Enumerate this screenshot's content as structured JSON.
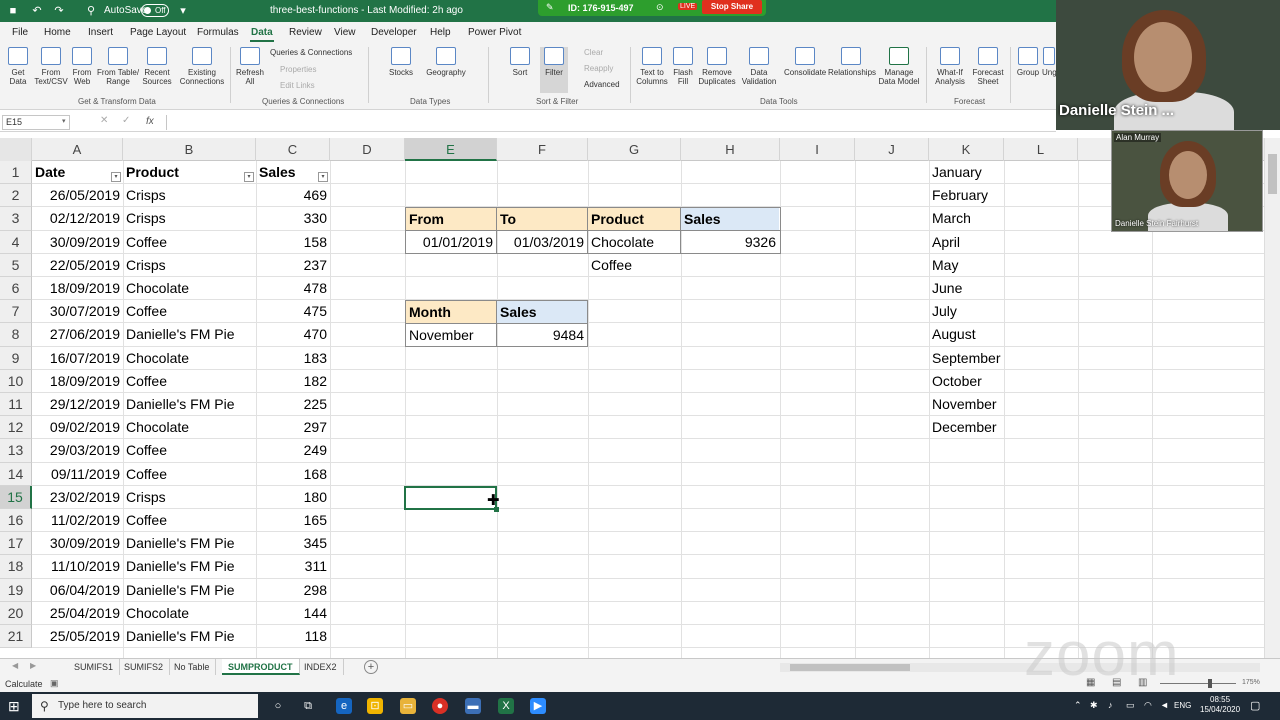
{
  "titlebar": {
    "autosave_label": "AutoSave",
    "autosave_state": "Off",
    "doc_title": "three-best-functions  -  Last Modified: 2h ago",
    "share_id": "ID: 176-915-497",
    "live_badge": "LIVE",
    "stop_share": "Stop Share"
  },
  "menu": {
    "tabs": [
      "File",
      "Home",
      "Insert",
      "Page Layout",
      "Formulas",
      "Data",
      "Review",
      "View",
      "Developer",
      "Help",
      "Power Pivot"
    ],
    "active": "Data"
  },
  "ribbon": {
    "get_data": "Get\nData",
    "from_text": "From\nText/CSV",
    "from_web": "From\nWeb",
    "from_table": "From Table/\nRange",
    "recent_sources": "Recent\nSources",
    "existing_connections": "Existing\nConnections",
    "group_get_transform": "Get & Transform Data",
    "refresh_all": "Refresh\nAll",
    "queries_connections": "Queries & Connections",
    "properties": "Properties",
    "edit_links": "Edit Links",
    "group_queries": "Queries & Connections",
    "stocks": "Stocks",
    "geography": "Geography",
    "group_data_types": "Data Types",
    "sort": "Sort",
    "filter": "Filter",
    "clear": "Clear",
    "reapply": "Reapply",
    "advanced": "Advanced",
    "group_sort_filter": "Sort & Filter",
    "text_to_columns": "Text to\nColumns",
    "flash_fill": "Flash\nFill",
    "remove_duplicates": "Remove\nDuplicates",
    "data_validation": "Data\nValidation",
    "consolidate": "Consolidate",
    "relationships": "Relationships",
    "manage_data_model": "Manage\nData Model",
    "group_data_tools": "Data Tools",
    "what_if": "What-If\nAnalysis",
    "forecast_sheet": "Forecast\nSheet",
    "group_forecast": "Forecast",
    "group": "Group",
    "ungroup": "Ung"
  },
  "formula_bar": {
    "name_box": "E15",
    "fx": "fx",
    "formula": ""
  },
  "columns": [
    "A",
    "B",
    "C",
    "D",
    "E",
    "F",
    "G",
    "H",
    "I",
    "J",
    "K",
    "L"
  ],
  "rows": [
    "1",
    "2",
    "3",
    "4",
    "5",
    "6",
    "7",
    "8",
    "9",
    "10",
    "11",
    "12",
    "13",
    "14",
    "15",
    "16",
    "17",
    "18",
    "19",
    "20",
    "21"
  ],
  "table": {
    "headers": [
      "Date",
      "Product",
      "Sales"
    ],
    "rows": [
      [
        "26/05/2019",
        "Crisps",
        "469"
      ],
      [
        "02/12/2019",
        "Crisps",
        "330"
      ],
      [
        "30/09/2019",
        "Coffee",
        "158"
      ],
      [
        "22/05/2019",
        "Crisps",
        "237"
      ],
      [
        "18/09/2019",
        "Chocolate",
        "478"
      ],
      [
        "30/07/2019",
        "Coffee",
        "475"
      ],
      [
        "27/06/2019",
        "Danielle's FM Pie",
        "470"
      ],
      [
        "16/07/2019",
        "Chocolate",
        "183"
      ],
      [
        "18/09/2019",
        "Coffee",
        "182"
      ],
      [
        "29/12/2019",
        "Danielle's FM Pie",
        "225"
      ],
      [
        "09/02/2019",
        "Chocolate",
        "297"
      ],
      [
        "29/03/2019",
        "Coffee",
        "249"
      ],
      [
        "09/11/2019",
        "Coffee",
        "168"
      ],
      [
        "23/02/2019",
        "Crisps",
        "180"
      ],
      [
        "11/02/2019",
        "Coffee",
        "165"
      ],
      [
        "30/09/2019",
        "Danielle's FM Pie",
        "345"
      ],
      [
        "11/10/2019",
        "Danielle's FM Pie",
        "311"
      ],
      [
        "06/04/2019",
        "Danielle's FM Pie",
        "298"
      ],
      [
        "25/04/2019",
        "Chocolate",
        "144"
      ],
      [
        "25/05/2019",
        "Danielle's FM Pie",
        "118"
      ]
    ]
  },
  "criteria": {
    "headers": [
      "From",
      "To",
      "Product",
      "Sales"
    ],
    "from": "01/01/2019",
    "to": "01/03/2019",
    "product": "Chocolate",
    "sales": "9326",
    "product2": "Coffee"
  },
  "month_box": {
    "headers": [
      "Month",
      "Sales"
    ],
    "month": "November",
    "sales": "9484"
  },
  "months": [
    "January",
    "February",
    "March",
    "April",
    "May",
    "June",
    "July",
    "August",
    "September",
    "October",
    "November",
    "December"
  ],
  "sheets": [
    "SUMIFS1",
    "SUMIFS2",
    "No Table",
    "SUMPRODUCT",
    "INDEX2"
  ],
  "active_sheet": "SUMPRODUCT",
  "status": "Calculate",
  "zoom_level": "175%",
  "taskbar": {
    "search_placeholder": "Type here to search",
    "lang": "ENG",
    "time": "08:55",
    "date": "15/04/2020"
  },
  "zoom": {
    "watermark": "zoom",
    "main_name": "Danielle Stein ...",
    "thumb_top": "Alan Murray",
    "thumb_name": "Danielle Stein Fairhurst"
  },
  "colors": {
    "excel_green": "#217346",
    "header_yellow": "#fde9c5",
    "header_blue": "#dbe8f6"
  }
}
